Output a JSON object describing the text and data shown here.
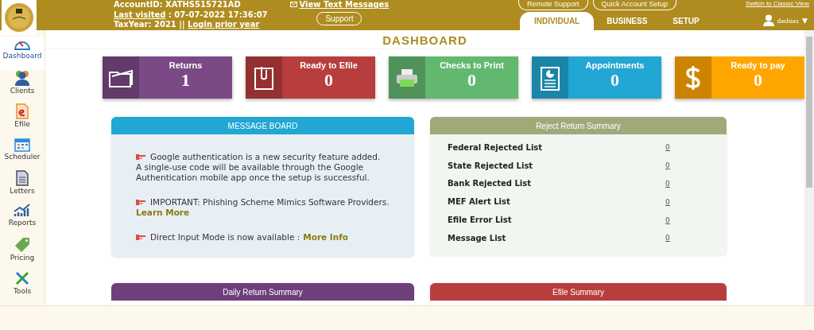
{
  "header": {
    "account_id": "AccountID:  XATHS515721AD",
    "last_visited_label": "Last visited",
    "last_visited_value": " : 07-07-2022 17:36:07",
    "tax_year": "TaxYear:  2021  ||",
    "login_prior_year": "Login prior year",
    "view_text_messages": "View Text Messages",
    "support": "Support",
    "remote_support": "Remote Support",
    "quick_account_setup": "Quick Account Setup",
    "switch_view": "Switch to Classic View",
    "user": "dashtax",
    "user_caret": "▼"
  },
  "tabs": [
    {
      "label": "INDIVIDUAL",
      "selected": true
    },
    {
      "label": "BUSINESS",
      "selected": false
    },
    {
      "label": "SETUP",
      "selected": false
    }
  ],
  "sidebar": {
    "items": [
      {
        "label": "Dashboard",
        "kind": "gauge",
        "selected": true
      },
      {
        "label": "Clients",
        "kind": "people",
        "selected": false
      },
      {
        "label": "Efile",
        "kind": "efile",
        "selected": false
      },
      {
        "label": "Scheduler",
        "kind": "calendar",
        "selected": false
      },
      {
        "label": "Letters",
        "kind": "letter",
        "selected": false
      },
      {
        "label": "Reports",
        "kind": "chart",
        "selected": false
      },
      {
        "label": "Pricing",
        "kind": "tag",
        "selected": false
      },
      {
        "label": "Tools",
        "kind": "tools",
        "selected": false
      }
    ]
  },
  "page_title": "DASHBOARD",
  "tiles": [
    {
      "label": "Returns",
      "value": "1",
      "kind": "folder",
      "color": "#7b4a86"
    },
    {
      "label": "Ready to Efile",
      "value": "0",
      "kind": "clip",
      "color": "#b83d3d"
    },
    {
      "label": "Checks to Print",
      "value": "0",
      "kind": "printer",
      "color": "#63b870"
    },
    {
      "label": "Appointments",
      "value": "0",
      "kind": "clipboard",
      "color": "#22a6d3"
    },
    {
      "label": "Ready to pay",
      "value": "0",
      "kind": "dollar",
      "color": "#ffa500"
    }
  ],
  "message_board": {
    "title": "MESSAGE BOARD",
    "messages": [
      {
        "text": "Google authentication is a new security feature added.",
        "detail": "A single-use code will be available through the Google Authentication mobile app once the setup is successful."
      },
      {
        "text": "IMPORTANT: Phishing Scheme Mimics Software Providers.",
        "link": "Learn More",
        "link_inline": false
      },
      {
        "text": "Direct Input Mode is now available :",
        "link": "More Info",
        "link_inline": true
      }
    ]
  },
  "reject_summary": {
    "title": "Reject Return Summary",
    "rows": [
      {
        "label": "Federal Rejected List",
        "count": "0"
      },
      {
        "label": "State Rejected List",
        "count": "0"
      },
      {
        "label": "Bank Rejected List",
        "count": "0"
      },
      {
        "label": "MEF Alert List",
        "count": "0"
      },
      {
        "label": "Efile Error List",
        "count": "0"
      },
      {
        "label": "Message List",
        "count": "0"
      }
    ]
  },
  "bottom_panels": [
    {
      "title": "Daily Return Summary",
      "color": "#6e3f7a"
    },
    {
      "title": "Efile Summary",
      "color": "#b83d3d"
    }
  ]
}
